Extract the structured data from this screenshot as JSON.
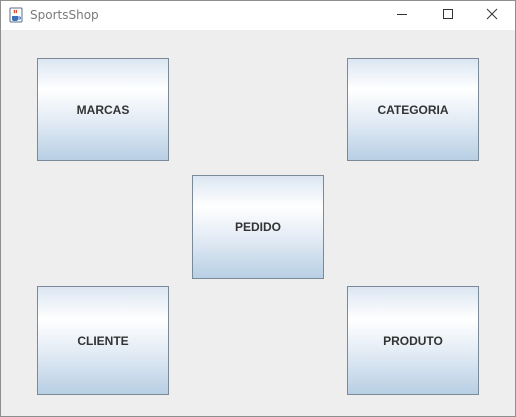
{
  "window": {
    "title": "SportsShop",
    "icon": "java-cup-icon",
    "controls": {
      "minimize": "minimize-icon",
      "maximize": "maximize-icon",
      "close": "close-icon"
    }
  },
  "buttons": {
    "marcas": "MARCAS",
    "categoria": "CATEGORIA",
    "pedido": "PEDIDO",
    "cliente": "CLIENTE",
    "produto": "PRODUTO"
  }
}
